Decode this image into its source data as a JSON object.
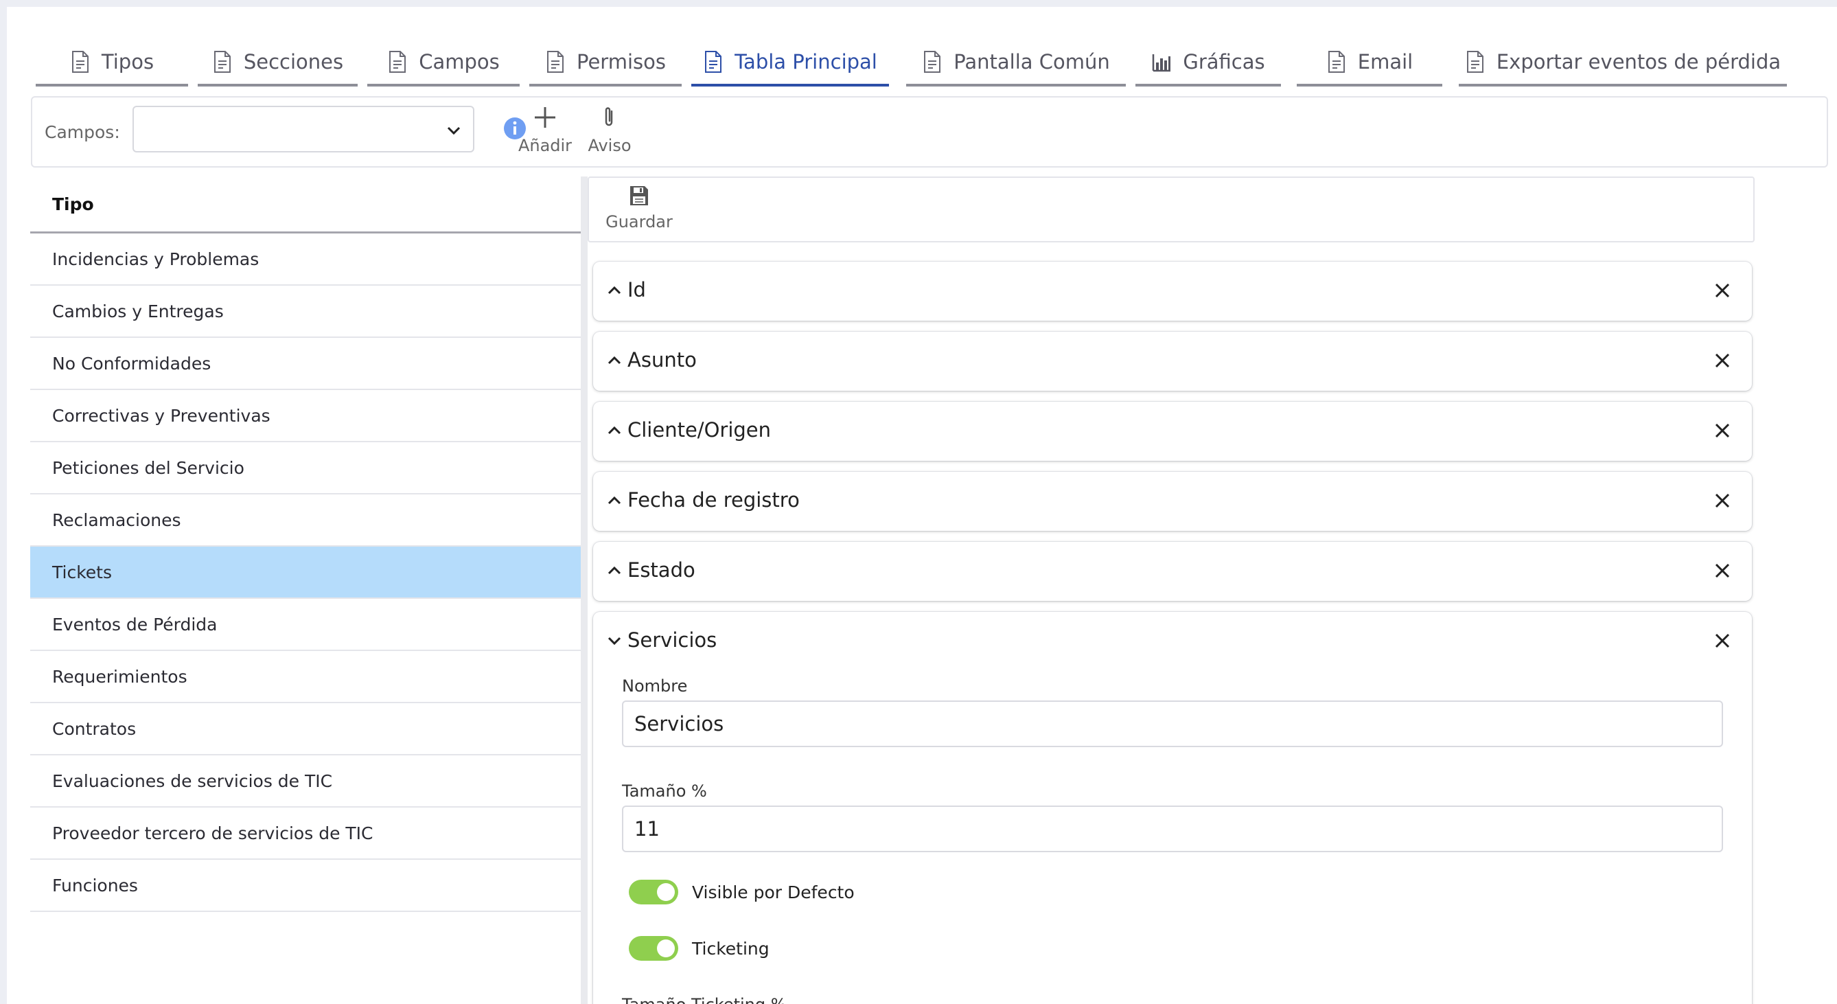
{
  "tabs": [
    {
      "label": "Tipos",
      "icon": "document-icon"
    },
    {
      "label": "Secciones",
      "icon": "document-icon"
    },
    {
      "label": "Campos",
      "icon": "document-icon"
    },
    {
      "label": "Permisos",
      "icon": "document-icon"
    },
    {
      "label": "Tabla Principal",
      "icon": "document-icon",
      "active": true
    },
    {
      "label": "Pantalla Común",
      "icon": "document-icon"
    },
    {
      "label": "Gráficas",
      "icon": "bar-chart-icon"
    },
    {
      "label": "Email",
      "icon": "document-icon"
    },
    {
      "label": "Exportar eventos de pérdida",
      "icon": "document-icon"
    }
  ],
  "toolbar": {
    "campos_label": "Campos:",
    "campos_value": "",
    "add_label": "Añadir",
    "notice_label": "Aviso"
  },
  "list": {
    "header": "Tipo",
    "items": [
      "Incidencias y Problemas",
      "Cambios y Entregas",
      "No Conformidades",
      "Correctivas y Preventivas",
      "Peticiones del Servicio",
      "Reclamaciones",
      "Tickets",
      "Eventos de Pérdida",
      "Requerimientos",
      "Contratos",
      "Evaluaciones de servicios de TIC",
      "Proveedor tercero de servicios de TIC",
      "Funciones"
    ],
    "selected": "Tickets"
  },
  "save_label": "Guardar",
  "accordions": [
    "Id",
    "Asunto",
    "Cliente/Origen",
    "Fecha de registro",
    "Estado",
    "Servicios"
  ],
  "servicios": {
    "nombre_label": "Nombre",
    "nombre_value": "Servicios",
    "tamano_label": "Tamaño %",
    "tamano_value": "11",
    "visible_label": "Visible por Defecto",
    "visible_on": true,
    "ticketing_label": "Ticketing",
    "ticketing_on": true,
    "tamano_ticketing_label": "Tamaño Ticketing %"
  },
  "colors": {
    "accent": "#2d4fa8",
    "selected_row": "#b5dcfb",
    "toggle_on": "#8fcf4e",
    "info": "#6f9ef2"
  }
}
